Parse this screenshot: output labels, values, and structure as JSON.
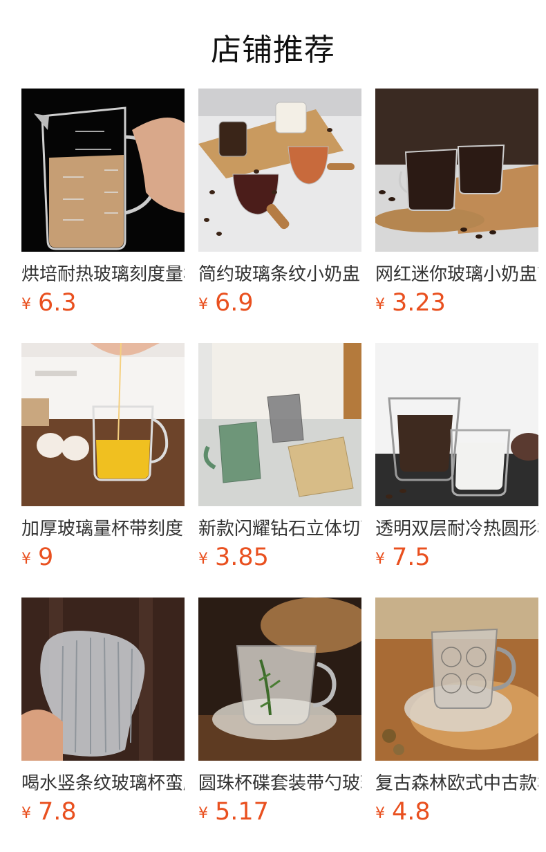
{
  "section_title": "店铺推荐",
  "currency_symbol": "¥",
  "colors": {
    "price": "#e9501f",
    "title": "#111111",
    "name": "#333333"
  },
  "products": [
    {
      "name": "烘培耐热玻璃刻度量杯",
      "price": "6.3",
      "image": "measuring-cup-photo"
    },
    {
      "name": "简约玻璃条纹小奶盅",
      "price": "6.9",
      "image": "milk-jugs-photo"
    },
    {
      "name": "网红迷你玻璃小奶盅带刻度",
      "price": "3.23",
      "image": "espresso-cups-photo"
    },
    {
      "name": "加厚玻璃量杯带刻度家用",
      "price": "9",
      "image": "measuring-jug-photo"
    },
    {
      "name": "新款闪耀钻石立体切面杯",
      "price": "3.85",
      "image": "diamond-cups-photo"
    },
    {
      "name": "透明双层耐冷热圆形杯",
      "price": "7.5",
      "image": "double-wall-cups-photo"
    },
    {
      "name": "喝水竖条纹玻璃杯蛮腰",
      "price": "7.8",
      "image": "ribbed-glass-photo"
    },
    {
      "name": "圆珠杯碟套装带勺玻璃",
      "price": "5.17",
      "image": "cup-saucer-photo"
    },
    {
      "name": "复古森林欧式中古款杯",
      "price": "4.8",
      "image": "vintage-cup-photo"
    }
  ]
}
